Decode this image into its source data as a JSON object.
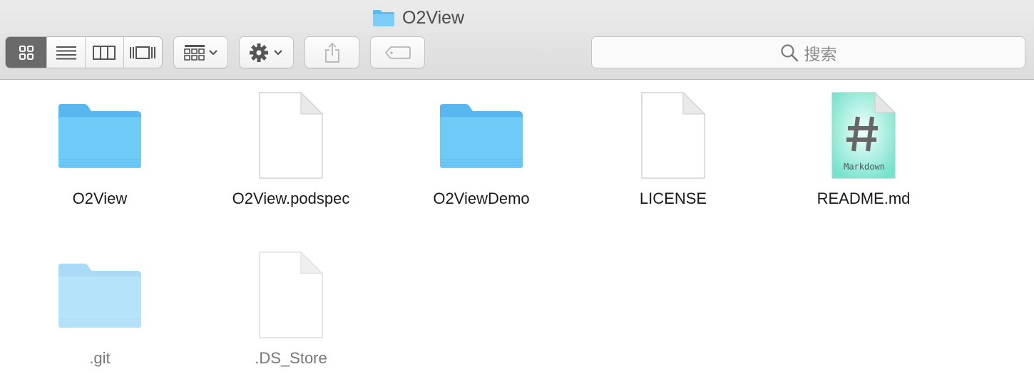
{
  "window": {
    "title": "O2View"
  },
  "toolbar": {
    "view_modes": [
      {
        "name": "icon-view",
        "active": true
      },
      {
        "name": "list-view",
        "active": false
      },
      {
        "name": "column-view",
        "active": false
      },
      {
        "name": "cover-flow-view",
        "active": false
      }
    ],
    "arrange_icon": "grid-arrange-icon",
    "action_icon": "gear-icon",
    "share_icon": "share-icon",
    "tags_icon": "tag-icon",
    "search": {
      "placeholder": "搜索",
      "icon": "search-icon"
    }
  },
  "items": [
    {
      "label": "O2View",
      "kind": "folder",
      "hidden": false
    },
    {
      "label": "O2View.podspec",
      "kind": "document",
      "hidden": false
    },
    {
      "label": "O2ViewDemo",
      "kind": "folder",
      "hidden": false
    },
    {
      "label": "LICENSE",
      "kind": "document",
      "hidden": false
    },
    {
      "label": "README.md",
      "kind": "markdown",
      "hidden": false,
      "badge": "Markdown"
    },
    {
      "label": ".git",
      "kind": "folder",
      "hidden": true
    },
    {
      "label": ".DS_Store",
      "kind": "document",
      "hidden": true
    }
  ],
  "colors": {
    "folder": "#6cc6f6",
    "folder_tab": "#8ed2f7",
    "markdown_teal": "#7fe3cf",
    "active_segment": "#6a6a6a"
  }
}
